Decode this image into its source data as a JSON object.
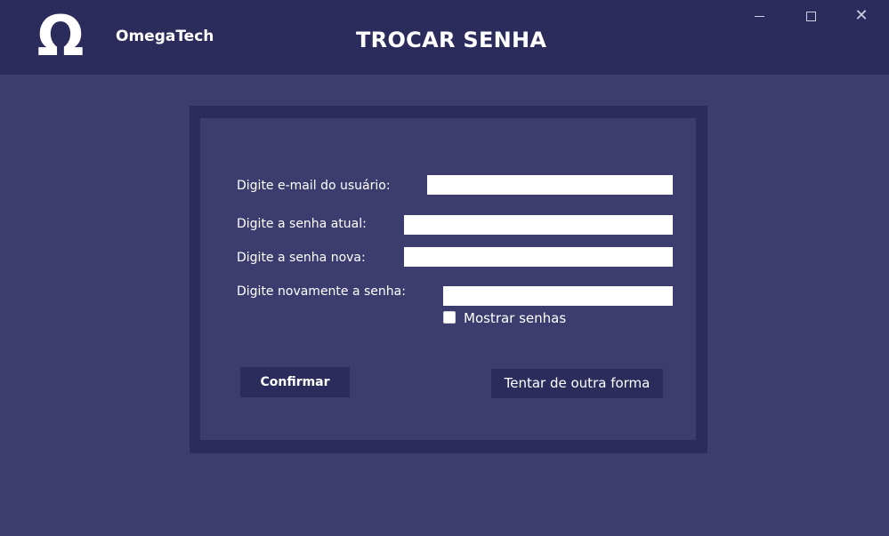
{
  "app": {
    "brand": "OmegaTech",
    "logo_glyph": "Ω",
    "title": "TROCAR SENHA"
  },
  "window_controls": {
    "minimize": "minimize",
    "maximize": "maximize",
    "close": "close"
  },
  "form": {
    "email_label": "Digite e-mail do usuário:",
    "email_value": "",
    "current_password_label": "Digite a senha atual:",
    "current_password_value": "",
    "new_password_label": "Digite a senha nova:",
    "new_password_value": "",
    "repeat_password_label": "Digite novamente a senha:",
    "repeat_password_value": "",
    "show_passwords_label": "Mostrar senhas",
    "show_passwords_checked": false
  },
  "buttons": {
    "confirm": "Confirmar",
    "try_other": "Tentar de outra forma"
  },
  "colors": {
    "background": "#3c3d6e",
    "header": "#2b2c5c",
    "text": "#ffffff"
  }
}
